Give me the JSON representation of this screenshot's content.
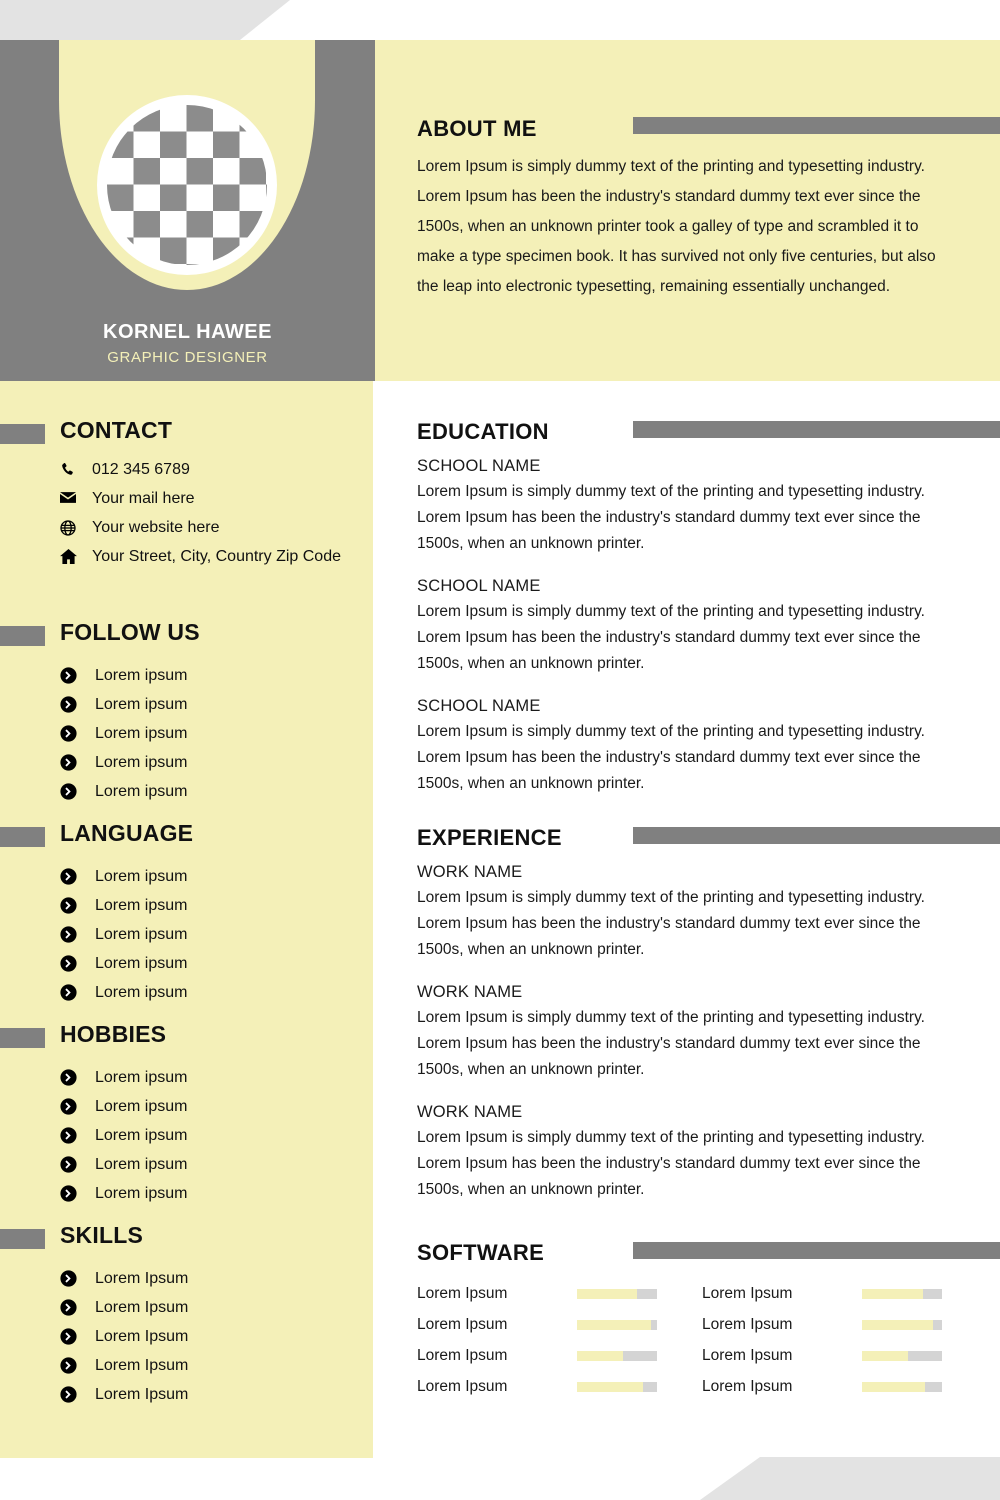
{
  "colors": {
    "yellow": "#f4f0b8",
    "gray": "#808080",
    "light_gray": "#e3e3e3",
    "track_gray": "#d4d4d4",
    "text": "#1a1a1a"
  },
  "profile": {
    "name": "KORNEL HAWEE",
    "role": "GRAPHIC DESIGNER",
    "avatar_icon": "placeholder-checker-image"
  },
  "about": {
    "title": "ABOUT ME",
    "text": "Lorem Ipsum is simply dummy text of the printing and typesetting industry. Lorem Ipsum has been the industry's standard dummy text ever since the 1500s, when an unknown printer took a galley of type and scrambled it to make a type specimen book. It has survived not only five centuries, but also the leap into electronic typesetting, remaining essentially unchanged."
  },
  "contact": {
    "title": "CONTACT",
    "items": [
      {
        "icon": "phone-icon",
        "value": "012 345 6789"
      },
      {
        "icon": "mail-icon",
        "value": "Your mail here"
      },
      {
        "icon": "globe-icon",
        "value": "Your website here"
      },
      {
        "icon": "home-icon",
        "value": "Your Street, City, Country Zip Code"
      }
    ]
  },
  "follow_us": {
    "title": "FOLLOW US",
    "items": [
      "Lorem ipsum",
      "Lorem ipsum",
      "Lorem ipsum",
      "Lorem ipsum",
      "Lorem ipsum"
    ]
  },
  "language": {
    "title": "LANGUAGE",
    "items": [
      "Lorem ipsum",
      "Lorem ipsum",
      "Lorem ipsum",
      "Lorem ipsum",
      "Lorem ipsum"
    ]
  },
  "hobbies": {
    "title": "HOBBIES",
    "items": [
      "Lorem ipsum",
      "Lorem ipsum",
      "Lorem ipsum",
      "Lorem ipsum",
      "Lorem ipsum"
    ]
  },
  "skills": {
    "title": "SKILLS",
    "items": [
      "Lorem Ipsum",
      "Lorem Ipsum",
      "Lorem Ipsum",
      "Lorem Ipsum",
      "Lorem Ipsum"
    ]
  },
  "education": {
    "title": "EDUCATION",
    "entries": [
      {
        "name": "SCHOOL NAME",
        "body": "Lorem Ipsum is simply dummy text of the printing and typesetting industry. Lorem Ipsum has been the industry's standard dummy text ever since the 1500s, when an unknown printer."
      },
      {
        "name": "SCHOOL NAME",
        "body": "Lorem Ipsum is simply dummy text of the printing and typesetting industry. Lorem Ipsum has been the industry's standard dummy text ever since the 1500s, when an unknown printer."
      },
      {
        "name": "SCHOOL NAME",
        "body": "Lorem Ipsum is simply dummy text of the printing and typesetting industry. Lorem Ipsum has been the industry's standard dummy text ever since the 1500s, when an unknown printer."
      }
    ]
  },
  "experience": {
    "title": "EXPERIENCE",
    "entries": [
      {
        "name": "WORK NAME",
        "body": "Lorem Ipsum is simply dummy text of the printing and typesetting industry. Lorem Ipsum has been the industry's standard dummy text ever since the 1500s, when an unknown printer."
      },
      {
        "name": "WORK NAME",
        "body": "Lorem Ipsum is simply dummy text of the printing and typesetting industry. Lorem Ipsum has been the industry's standard dummy text ever since the 1500s, when an unknown printer."
      },
      {
        "name": "WORK NAME",
        "body": "Lorem Ipsum is simply dummy text of the printing and typesetting industry. Lorem Ipsum has been the industry's standard dummy text ever since the 1500s, when an unknown printer."
      }
    ]
  },
  "software": {
    "title": "SOFTWARE",
    "rows": [
      {
        "left": {
          "label": "Lorem Ipsum",
          "percent": 75
        },
        "right": {
          "label": "Lorem Ipsum",
          "percent": 76
        }
      },
      {
        "left": {
          "label": "Lorem Ipsum",
          "percent": 92
        },
        "right": {
          "label": "Lorem Ipsum",
          "percent": 89
        }
      },
      {
        "left": {
          "label": "Lorem Ipsum",
          "percent": 58
        },
        "right": {
          "label": "Lorem Ipsum",
          "percent": 57
        }
      },
      {
        "left": {
          "label": "Lorem Ipsum",
          "percent": 82
        },
        "right": {
          "label": "Lorem Ipsum",
          "percent": 79
        }
      }
    ]
  }
}
